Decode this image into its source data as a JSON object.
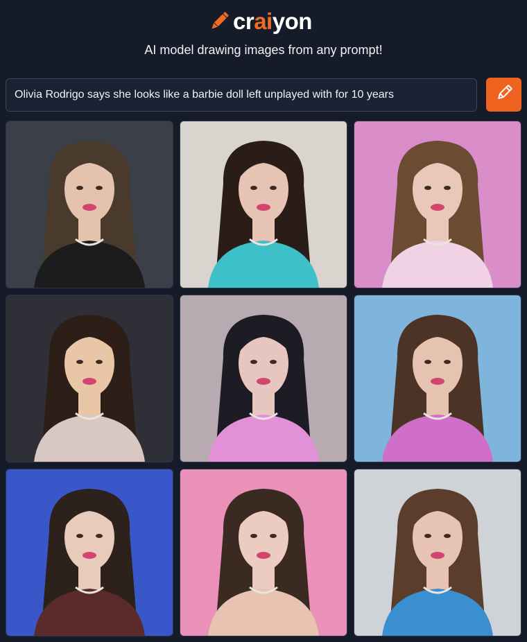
{
  "brand": {
    "prefix": "cr",
    "accent": "ai",
    "suffix": "yon",
    "logo_icon": "pencil-icon",
    "accent_color": "#f26b22"
  },
  "tagline": "AI model drawing images from any prompt!",
  "prompt": {
    "value": "Olivia Rodrigo says she looks like a barbie doll left unplayed with for 10 years"
  },
  "draw_button": {
    "icon": "pencil-icon",
    "color": "#f0621f"
  },
  "results": {
    "count": 9,
    "images": [
      {
        "bg": "#3a3f48",
        "hair": "#4a3a2c",
        "skin": "#e4c2ad",
        "outfit": "#1c1c1c"
      },
      {
        "bg": "#d9d4ce",
        "hair": "#2a1d18",
        "skin": "#e6c3b2",
        "outfit": "#3ec0c8"
      },
      {
        "bg": "#d98ec9",
        "hair": "#6b4b31",
        "skin": "#e9c7b9",
        "outfit": "#f1d2e4"
      },
      {
        "bg": "#2f2f38",
        "hair": "#2d1f17",
        "skin": "#e8c6a6",
        "outfit": "#d9c7c2"
      },
      {
        "bg": "#b7aab0",
        "hair": "#1d1b24",
        "skin": "#e7c6bf",
        "outfit": "#e291d9"
      },
      {
        "bg": "#7fb5dd",
        "hair": "#4b3426",
        "skin": "#e6c2b0",
        "outfit": "#d06ec9"
      },
      {
        "bg": "#3a57c9",
        "hair": "#2d211b",
        "skin": "#e9cbbb",
        "outfit": "#5a2b2a"
      },
      {
        "bg": "#ea91b9",
        "hair": "#3a2a22",
        "skin": "#eccbc0",
        "outfit": "#e8c3b1"
      },
      {
        "bg": "#cfd2d6",
        "hair": "#5a3d2b",
        "skin": "#e7c3b3",
        "outfit": "#3a8fd0"
      }
    ]
  }
}
